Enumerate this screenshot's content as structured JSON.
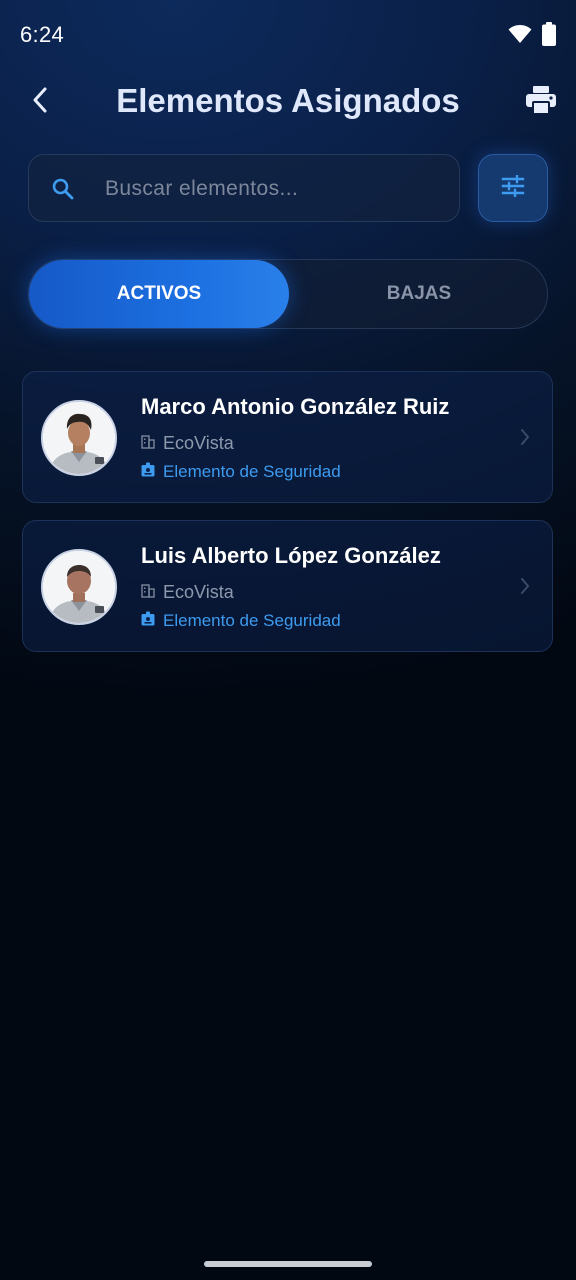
{
  "status_bar": {
    "time": "6:24"
  },
  "header": {
    "title": "Elementos Asignados"
  },
  "search": {
    "placeholder": "Buscar elementos..."
  },
  "tabs": [
    {
      "label": "ACTIVOS",
      "active": true
    },
    {
      "label": "BAJAS",
      "active": false
    }
  ],
  "items": [
    {
      "name": "Marco Antonio González Ruiz",
      "organization": "EcoVista",
      "role": "Elemento de Seguridad"
    },
    {
      "name": "Luis Alberto López González",
      "organization": "EcoVista",
      "role": "Elemento de Seguridad"
    }
  ],
  "colors": {
    "accent": "#1c6fe0",
    "role_text": "#3d9bf0",
    "background_top": "#0d2a5c",
    "background_bottom": "#020812"
  },
  "icons": {
    "back": "chevron-left-icon",
    "print": "printer-icon",
    "search": "search-icon",
    "filter": "tune-icon",
    "organization": "building-icon",
    "role": "id-badge-icon",
    "open": "chevron-right-icon",
    "wifi": "wifi-icon",
    "battery": "battery-icon"
  }
}
